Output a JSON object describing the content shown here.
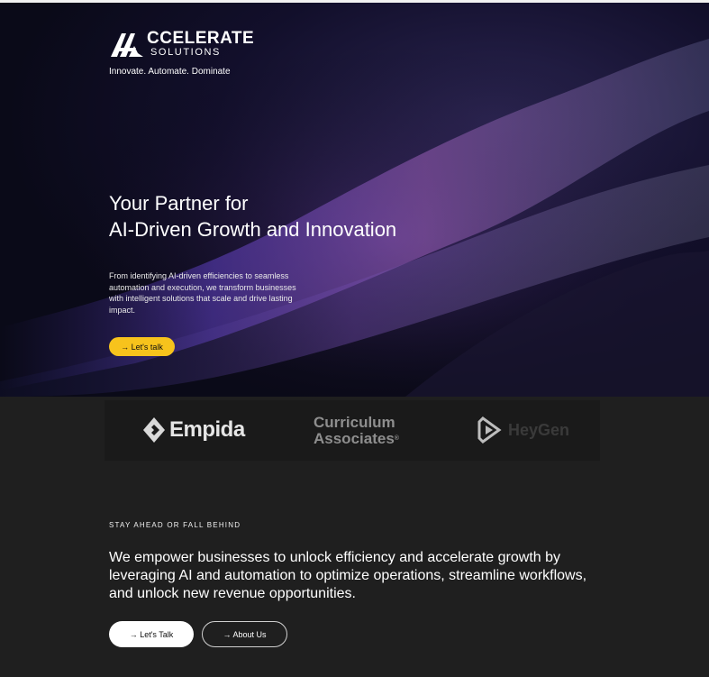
{
  "brand": {
    "logo_word": "CCELERATE",
    "logo_sub": "SOLUTIONS",
    "tagline": "Innovate. Automate. Dominate"
  },
  "hero": {
    "headline_line1": "Your Partner for",
    "headline_line2": "AI-Driven Growth and Innovation",
    "description": "From identifying AI-driven efficiencies to seamless automation and execution, we transform businesses with intelligent solutions that scale and drive lasting impact.",
    "cta_label": "→ Let's talk",
    "accent_color": "#f7c31c"
  },
  "clients": {
    "empida": "Empida",
    "curriculum_line1": "Curriculum",
    "curriculum_line2": "Associates",
    "curriculum_reg": "®",
    "heygen": "HeyGen"
  },
  "mission": {
    "eyebrow": "STAY AHEAD OR FALL BEHIND",
    "text": "We empower businesses to unlock efficiency and accelerate growth by leveraging AI and automation to optimize operations, streamline workflows, and unlock new revenue opportunities.",
    "primary_label": "→ Let's Talk",
    "secondary_label": "→ About Us"
  },
  "icons": [
    "accelerate-logo-icon",
    "empida-logo-icon",
    "heygen-logo-icon"
  ]
}
